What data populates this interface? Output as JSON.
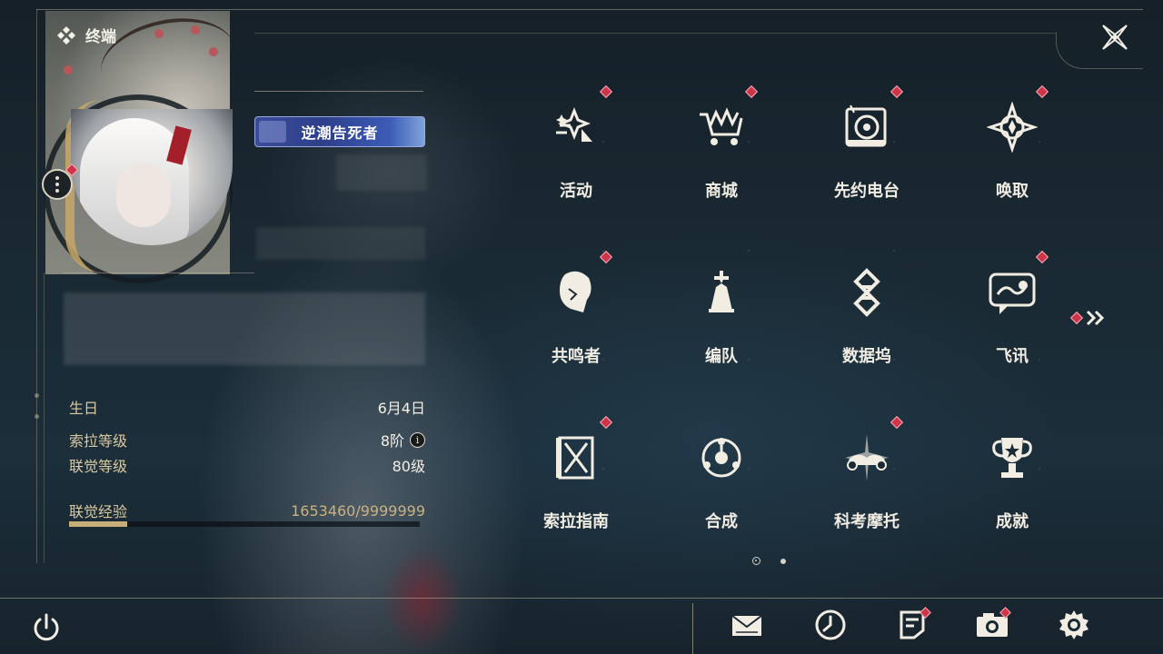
{
  "header": {
    "terminal_label": "终端"
  },
  "profile": {
    "title_badge": "逆潮告死者",
    "stats": {
      "birthday_label": "生日",
      "birthday_value": "6月4日",
      "sola_level_label": "索拉等级",
      "sola_level_value": "8阶",
      "union_level_label": "联觉等级",
      "union_level_value": "80级",
      "union_exp_label": "联觉经验",
      "union_exp_value": "1653460/9999999",
      "union_exp_progress": 0.165
    }
  },
  "menu": {
    "items": [
      {
        "label": "活动",
        "icon": "events-icon",
        "badge": true
      },
      {
        "label": "商城",
        "icon": "shop-cart-icon",
        "badge": true
      },
      {
        "label": "先约电台",
        "icon": "radio-icon",
        "badge": true
      },
      {
        "label": "唤取",
        "icon": "convene-icon",
        "badge": true
      },
      {
        "label": "共鸣者",
        "icon": "resonator-icon",
        "badge": true
      },
      {
        "label": "编队",
        "icon": "team-icon",
        "badge": false
      },
      {
        "label": "数据坞",
        "icon": "data-bank-icon",
        "badge": false
      },
      {
        "label": "飞讯",
        "icon": "message-icon",
        "badge": true
      },
      {
        "label": "索拉指南",
        "icon": "guide-icon",
        "badge": true
      },
      {
        "label": "合成",
        "icon": "synthesis-icon",
        "badge": false
      },
      {
        "label": "科考摩托",
        "icon": "motorcycle-icon",
        "badge": true
      },
      {
        "label": "成就",
        "icon": "trophy-icon",
        "badge": false
      }
    ],
    "page_current": 1,
    "page_total": 2
  },
  "bottom_bar": {
    "icons": [
      "power-icon",
      "mail-icon",
      "clock-icon",
      "notice-icon",
      "camera-icon",
      "settings-icon"
    ]
  },
  "colors": {
    "accent_gold": "#c7ad78",
    "badge_red": "#d0344a",
    "background": "#1a2a34"
  }
}
